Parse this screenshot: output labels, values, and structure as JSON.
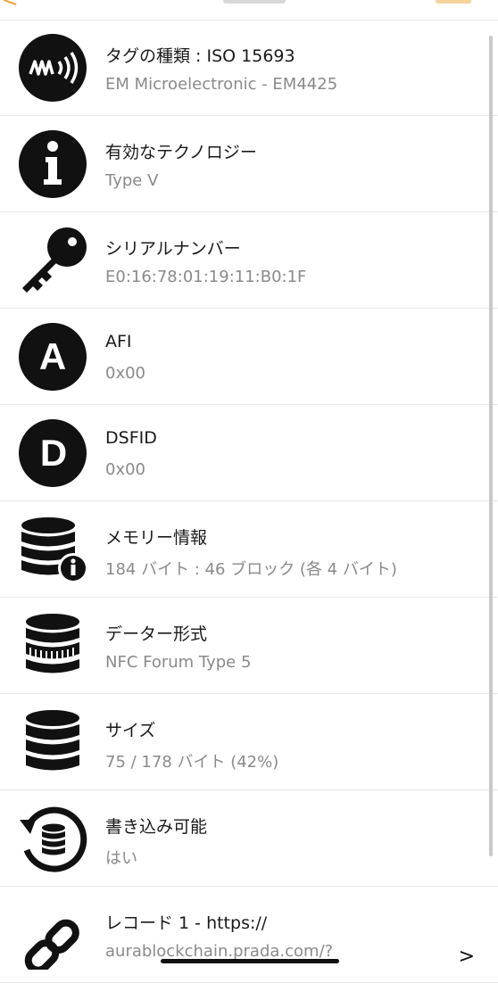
{
  "header": {
    "back_glyph": "<"
  },
  "rows": [
    {
      "title": "タグの種類 : ISO 15693",
      "sub": "EM Microelectronic - EM4425",
      "icon": "nfc-wave-icon"
    },
    {
      "title": "有効なテクノロジー",
      "sub": "Type V",
      "icon": "info-icon"
    },
    {
      "title": "シリアルナンバー",
      "sub": "E0:16:78:01:19:11:B0:1F",
      "icon": "key-icon"
    },
    {
      "title": "AFI",
      "sub": "0x00",
      "icon": "letter-a-icon",
      "icon_letter": "A"
    },
    {
      "title": "DSFID",
      "sub": "0x00",
      "icon": "letter-d-icon",
      "icon_letter": "D"
    },
    {
      "title": "メモリー情報",
      "sub": "184 バイト : 46 ブロック (各 4 バイト)",
      "icon": "database-info-icon"
    },
    {
      "title": "データー形式",
      "sub": "NFC Forum Type 5",
      "icon": "database-format-icon"
    },
    {
      "title": "サイズ",
      "sub": "75 / 178 バイト (42%)",
      "icon": "database-icon"
    },
    {
      "title": "書き込み可能",
      "sub": "はい",
      "icon": "database-restore-icon"
    },
    {
      "title": "レコード 1 - https://",
      "sub": "aurablockchain.prada.com/?",
      "icon": "link-icon",
      "chevron": ">"
    }
  ]
}
